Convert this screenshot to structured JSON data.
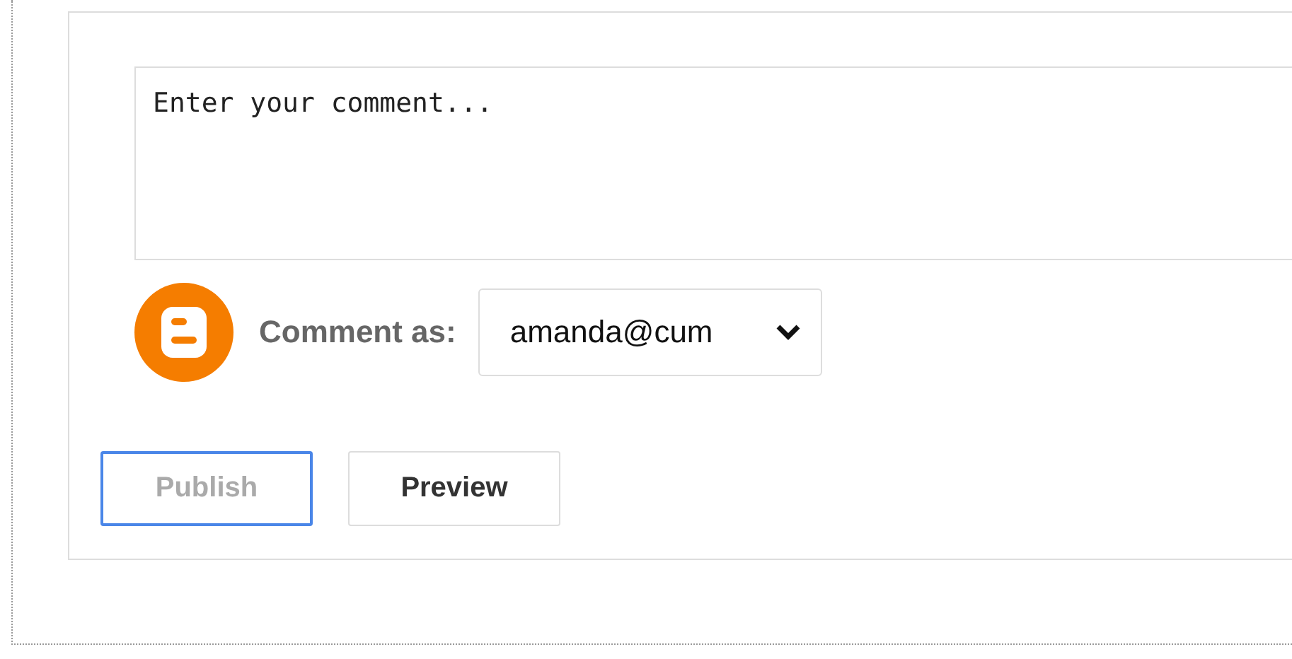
{
  "comment_box": {
    "placeholder": "Enter your comment..."
  },
  "identity": {
    "label": "Comment as:",
    "account": "amanda@cum"
  },
  "buttons": [
    {
      "label": "Publish",
      "disabled": true,
      "focused": true
    },
    {
      "label": "Preview",
      "disabled": false,
      "focused": false
    }
  ]
}
